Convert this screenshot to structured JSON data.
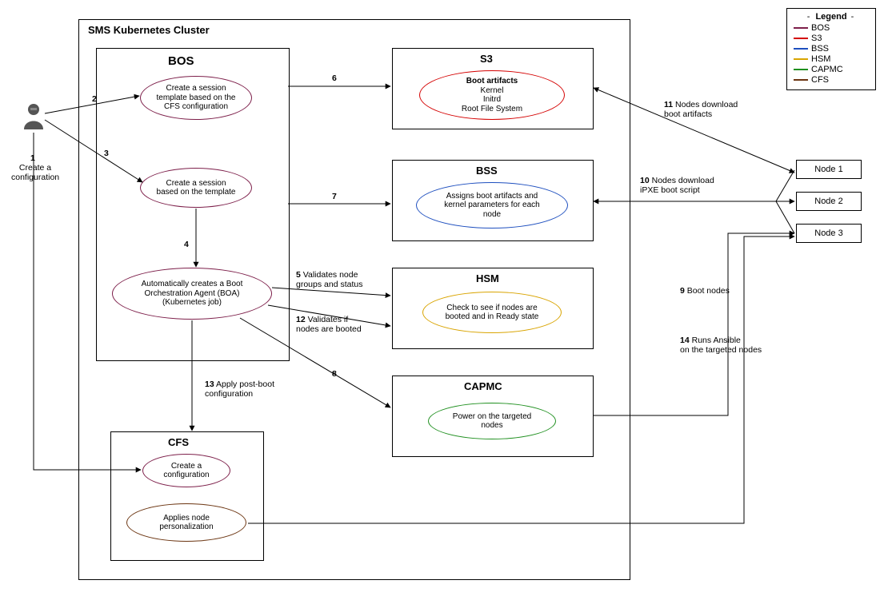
{
  "cluster_label": "SMS Kubernetes Cluster",
  "bos": {
    "title": "BOS",
    "session_template": "Create a session\ntemplate based on the\nCFS configuration",
    "create_session": "Create a session\nbased on the template",
    "boa": "Automatically creates a Boot\nOrchestration Agent (BOA)\n(Kubernetes job)"
  },
  "s3": {
    "title": "S3",
    "heading": "Boot artifacts",
    "lines": "Kernel\nInitrd\nRoot File System"
  },
  "bss": {
    "title": "BSS",
    "text": "Assigns boot artifacts and\nkernel parameters for each\nnode"
  },
  "hsm": {
    "title": "HSM",
    "text": "Check to see if nodes are\nbooted and in Ready state"
  },
  "capmc": {
    "title": "CAPMC",
    "text": "Power on the targeted\nnodes"
  },
  "cfs": {
    "title": "CFS",
    "create_config": "Create a\nconfiguration",
    "applies_personalization": "Applies node\npersonalization"
  },
  "nodes": {
    "n1": "Node 1",
    "n2": "Node 2",
    "n3": "Node 3"
  },
  "steps": {
    "s1_num": "1",
    "s1_text": "Create a\nconfiguration",
    "s2": "2",
    "s3": "3",
    "s4": "4",
    "s5": "5 Validates node\ngroups and status",
    "s6": "6",
    "s7": "7",
    "s8": "8",
    "s9": "9 Boot nodes",
    "s10": "10 Nodes download\niPXE boot script",
    "s11": "11 Nodes download\nboot artifacts",
    "s12": "12 Validates if\nnodes are booted",
    "s13": "13 Apply post-boot\nconfiguration",
    "s14": "14 Runs Ansible\non the targeted nodes"
  },
  "legend": {
    "title": "Legend",
    "items": [
      {
        "label": "BOS",
        "color": "#7d1f4a"
      },
      {
        "label": "S3",
        "color": "#d40000"
      },
      {
        "label": "BSS",
        "color": "#1e4fbf"
      },
      {
        "label": "HSM",
        "color": "#d9a400"
      },
      {
        "label": "CAPMC",
        "color": "#1e8f1e"
      },
      {
        "label": "CFS",
        "color": "#6b3410"
      }
    ]
  },
  "colors": {
    "bos": "#7d1f4a",
    "s3": "#d40000",
    "bss": "#1e4fbf",
    "hsm": "#d9a400",
    "capmc": "#1e8f1e",
    "cfs": "#6b3410"
  }
}
